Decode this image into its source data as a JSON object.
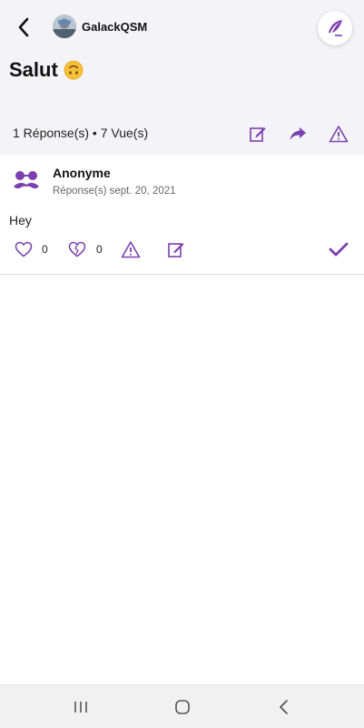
{
  "header": {
    "username": "GalackQSM",
    "icons": {
      "back": "back-arrow-icon",
      "compose": "feather-quill-icon"
    }
  },
  "post": {
    "title": "Salut",
    "title_emoji": "upside-down-face",
    "stats": "1 Réponse(s) • 7 Vue(s)",
    "actions": [
      "edit-icon",
      "share-icon",
      "report-warning-icon"
    ]
  },
  "reply": {
    "author": "Anonyme",
    "meta": "Réponse(s) sept. 20, 2021",
    "text": "Hey",
    "likes": "0",
    "dislikes": "0",
    "icons": [
      "heart-icon",
      "broken-heart-icon",
      "warning-icon",
      "edit-icon",
      "checkmark-icon"
    ]
  },
  "colors": {
    "accent": "#7b3fb0",
    "header_bg": "#f4f4f8"
  },
  "system_nav": [
    "recent-apps-icon",
    "home-icon",
    "back-icon"
  ]
}
